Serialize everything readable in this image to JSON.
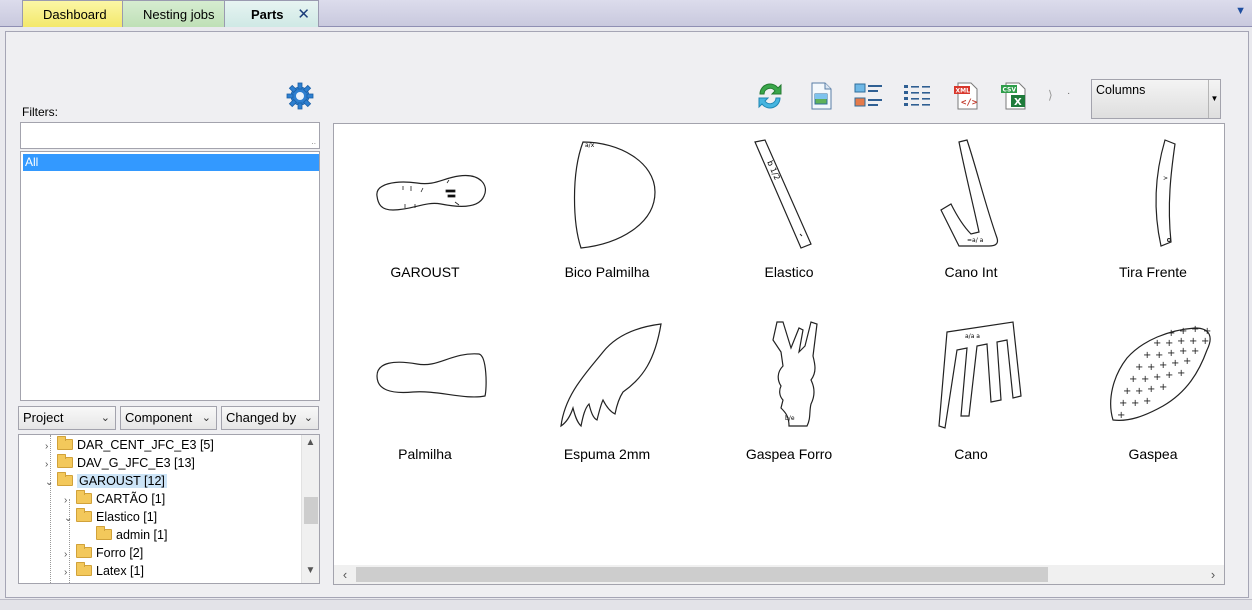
{
  "tabs": [
    {
      "label": "Dashboard",
      "color": "#f3e86b"
    },
    {
      "label": "Nesting jobs",
      "color": "#bfe0b7"
    },
    {
      "label": "Parts",
      "color": "#cfe9e5",
      "active": true,
      "close_glyph": "✕"
    }
  ],
  "left_panel": {
    "filters_label": "Filters:",
    "filter_input_value": "",
    "filter_items": [
      "All"
    ],
    "group_combos": [
      "Project",
      "Component",
      "Changed by"
    ],
    "tree": [
      {
        "label": "DAR_CENT_JFC_E3 [5]",
        "level": 0,
        "expander": "›"
      },
      {
        "label": "DAV_G_JFC_E3 [13]",
        "level": 0,
        "expander": "›"
      },
      {
        "label": "GAROUST [12]",
        "level": 0,
        "expander": "⌄",
        "selected": true
      },
      {
        "label": "CARTÃO [1]",
        "level": 1,
        "expander": "›"
      },
      {
        "label": "Elastico [1]",
        "level": 1,
        "expander": "⌄"
      },
      {
        "label": "admin [1]",
        "level": 2,
        "expander": ""
      },
      {
        "label": "Forro [2]",
        "level": 1,
        "expander": "›"
      },
      {
        "label": "Latex [1]",
        "level": 1,
        "expander": "›"
      }
    ]
  },
  "toolbar": {
    "icons": [
      "refresh-icon",
      "image-file-icon",
      "thumbnail-list-icon",
      "detail-list-icon",
      "xml-export-icon",
      "csv-export-icon"
    ],
    "columns_label": "Columns"
  },
  "parts": [
    {
      "name": "GAROUST",
      "shape": "insole"
    },
    {
      "name": "Bico Palmilha",
      "shape": "toe"
    },
    {
      "name": "Elastico",
      "shape": "strip"
    },
    {
      "name": "Cano Int",
      "shape": "l-shape"
    },
    {
      "name": "Tira Frente",
      "shape": "curved-strip"
    },
    {
      "name": "Palmilha",
      "shape": "insole-plain"
    },
    {
      "name": "Espuma 2mm",
      "shape": "wing"
    },
    {
      "name": "Gaspea Forro",
      "shape": "vamp-lining"
    },
    {
      "name": "Cano",
      "shape": "shaft"
    },
    {
      "name": "Gaspea",
      "shape": "vamp"
    }
  ]
}
